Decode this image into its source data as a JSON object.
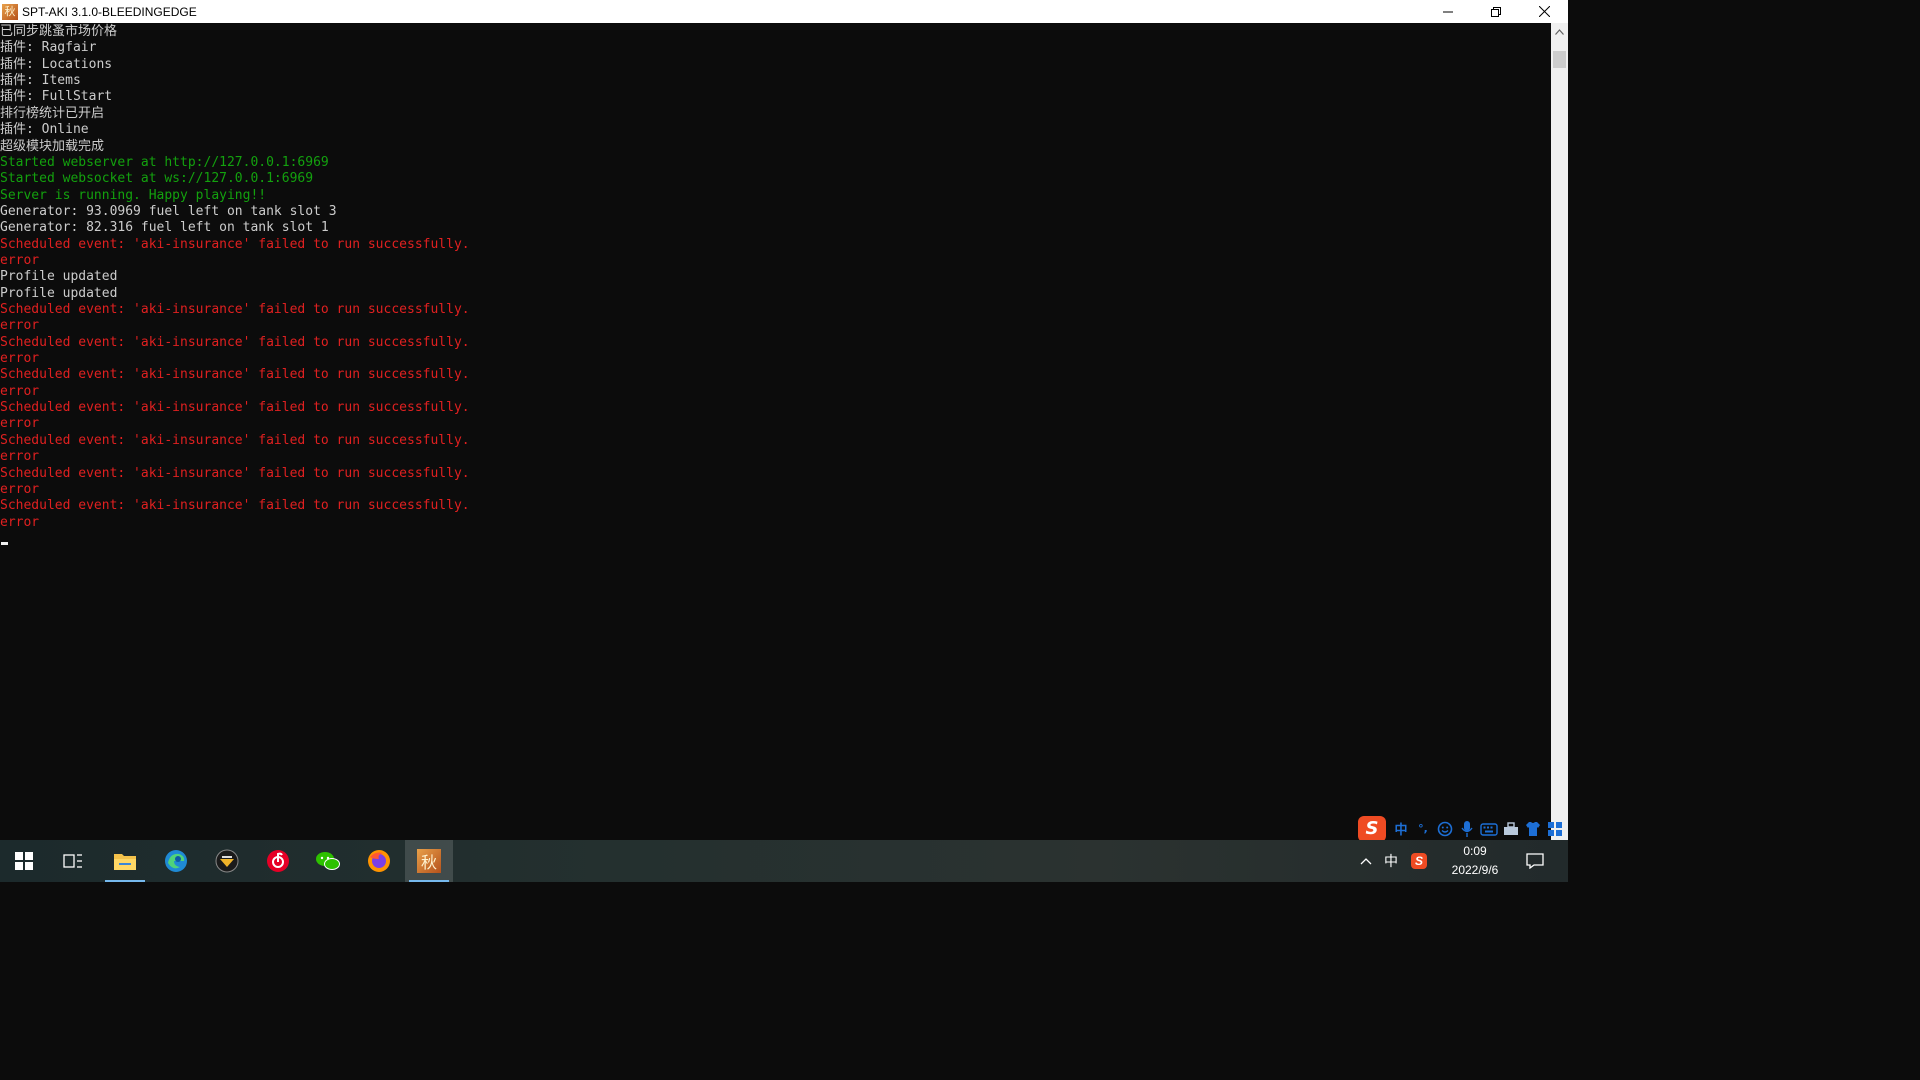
{
  "window": {
    "title": "SPT-AKI 3.1.0-BLEEDINGEDGE",
    "app_icon_glyph": "秋",
    "controls": [
      "minimize-icon",
      "restore-icon",
      "close-icon"
    ]
  },
  "console": {
    "lines": [
      {
        "text": "已同步跳蚤市场价格",
        "color": "gray"
      },
      {
        "text": "插件: Ragfair",
        "color": "gray"
      },
      {
        "text": "插件: Locations",
        "color": "gray"
      },
      {
        "text": "插件: Items",
        "color": "gray"
      },
      {
        "text": "插件: FullStart",
        "color": "gray"
      },
      {
        "text": "排行榜统计已开启",
        "color": "gray"
      },
      {
        "text": "插件: Online",
        "color": "gray"
      },
      {
        "text": "超级模块加载完成",
        "color": "gray"
      },
      {
        "text": "Started webserver at http://127.0.0.1:6969",
        "color": "green"
      },
      {
        "text": "Started websocket at ws://127.0.0.1:6969",
        "color": "green"
      },
      {
        "text": "Server is running. Happy playing!!",
        "color": "green"
      },
      {
        "text": "Generator: 93.0969 fuel left on tank slot 3",
        "color": "gray"
      },
      {
        "text": "Generator: 82.316 fuel left on tank slot 1",
        "color": "gray"
      },
      {
        "text": "Scheduled event: 'aki-insurance' failed to run successfully.",
        "color": "red"
      },
      {
        "text": "error",
        "color": "red"
      },
      {
        "text": "Profile updated",
        "color": "gray"
      },
      {
        "text": "Profile updated",
        "color": "gray"
      },
      {
        "text": "Scheduled event: 'aki-insurance' failed to run successfully.",
        "color": "red"
      },
      {
        "text": "error",
        "color": "red"
      },
      {
        "text": "Scheduled event: 'aki-insurance' failed to run successfully.",
        "color": "red"
      },
      {
        "text": "error",
        "color": "red"
      },
      {
        "text": "Scheduled event: 'aki-insurance' failed to run successfully.",
        "color": "red"
      },
      {
        "text": "error",
        "color": "red"
      },
      {
        "text": "Scheduled event: 'aki-insurance' failed to run successfully.",
        "color": "red"
      },
      {
        "text": "error",
        "color": "red"
      },
      {
        "text": "Scheduled event: 'aki-insurance' failed to run successfully.",
        "color": "red"
      },
      {
        "text": "error",
        "color": "red"
      },
      {
        "text": "Scheduled event: 'aki-insurance' failed to run successfully.",
        "color": "red"
      },
      {
        "text": "error",
        "color": "red"
      },
      {
        "text": "Scheduled event: 'aki-insurance' failed to run successfully.",
        "color": "red"
      },
      {
        "text": "error",
        "color": "red"
      }
    ],
    "colors": {
      "gray": "#cccccc",
      "green": "#13a10e",
      "red": "#e02020",
      "background": "#0c0c0c"
    }
  },
  "ime_toolbar": {
    "logo": "S",
    "mode": "中",
    "punct": "°,",
    "icons": [
      "emoji-icon",
      "microphone-icon",
      "keyboard-icon",
      "toolbox-icon",
      "skin-icon",
      "grid-icon"
    ]
  },
  "taskbar": {
    "apps": [
      "start-icon",
      "task-view-icon",
      "file-explorer-icon",
      "edge-icon",
      "app-launcher-icon",
      "netease-music-icon",
      "wechat-icon",
      "firefox-icon",
      "spt-aki-icon"
    ],
    "tray": {
      "chevron": "^",
      "ime_mode": "中",
      "time": "0:09",
      "date": "2022/9/6"
    }
  }
}
